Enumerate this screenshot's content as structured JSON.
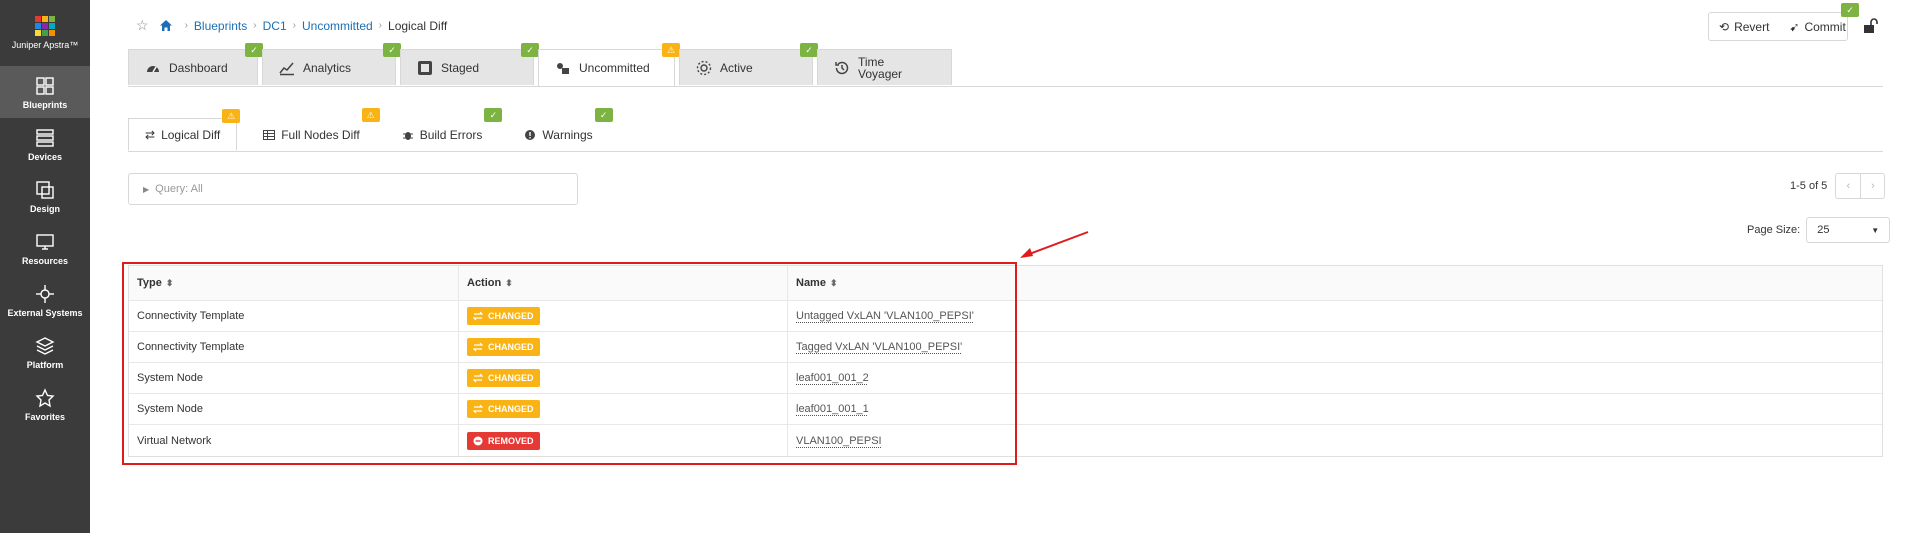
{
  "colors": {
    "accent": "#1a6fb5",
    "changed": "#f9b314",
    "removed": "#e53935",
    "ok": "#7cb342",
    "annotation": "#e01b1b"
  },
  "app": {
    "name": "Juniper Apstra™"
  },
  "sidebar": {
    "items": [
      {
        "label": "Blueprints",
        "icon": "blueprints-icon",
        "active": true
      },
      {
        "label": "Devices",
        "icon": "devices-icon"
      },
      {
        "label": "Design",
        "icon": "design-icon"
      },
      {
        "label": "Resources",
        "icon": "resources-icon"
      },
      {
        "label": "External Systems",
        "icon": "external-systems-icon"
      },
      {
        "label": "Platform",
        "icon": "platform-icon"
      },
      {
        "label": "Favorites",
        "icon": "star-icon"
      }
    ]
  },
  "breadcrumb": {
    "items": [
      "Blueprints",
      "DC1",
      "Uncommitted"
    ],
    "current": "Logical Diff"
  },
  "actions": {
    "revert": "Revert",
    "commit": "Commit"
  },
  "tabs": [
    {
      "label": "Dashboard",
      "status": "ok"
    },
    {
      "label": "Analytics",
      "status": "ok"
    },
    {
      "label": "Staged",
      "status": "ok"
    },
    {
      "label": "Uncommitted",
      "status": "warn",
      "active": true
    },
    {
      "label": "Active",
      "status": "ok"
    },
    {
      "label": "Time Voyager",
      "line1": "Time",
      "line2": "Voyager"
    }
  ],
  "subtabs": [
    {
      "label": "Logical Diff",
      "status": "warn",
      "active": true
    },
    {
      "label": "Full Nodes Diff",
      "status": "warn"
    },
    {
      "label": "Build Errors",
      "status": "ok"
    },
    {
      "label": "Warnings",
      "status": "ok"
    }
  ],
  "query": {
    "label": "Query: All"
  },
  "pager": {
    "range": "1-5 of 5",
    "page_size_label": "Page Size:",
    "page_size": "25"
  },
  "table": {
    "headers": [
      "Type",
      "Action",
      "Name"
    ],
    "rows": [
      {
        "type": "Connectivity Template",
        "action": "CHANGED",
        "name": "Untagged VxLAN 'VLAN100_PEPSI'"
      },
      {
        "type": "Connectivity Template",
        "action": "CHANGED",
        "name": "Tagged VxLAN 'VLAN100_PEPSI'"
      },
      {
        "type": "System Node",
        "action": "CHANGED",
        "name": "leaf001_001_2"
      },
      {
        "type": "System Node",
        "action": "CHANGED",
        "name": "leaf001_001_1"
      },
      {
        "type": "Virtual Network",
        "action": "REMOVED",
        "name": "VLAN100_PEPSI"
      }
    ]
  }
}
